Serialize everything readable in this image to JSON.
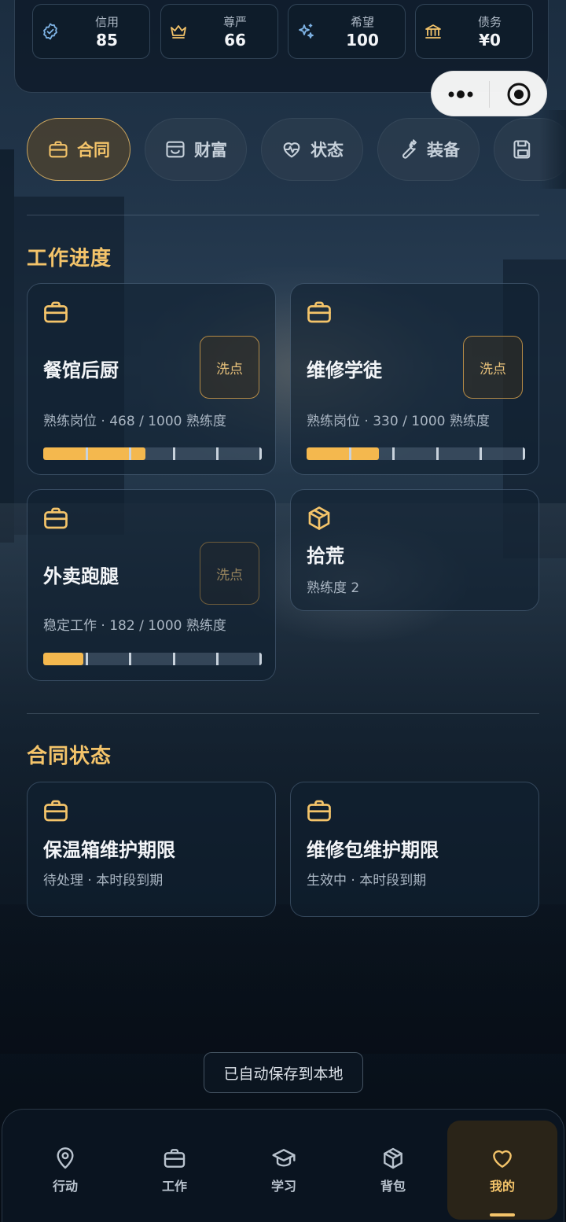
{
  "stats": [
    {
      "icon": "shield-check-icon",
      "label": "信用",
      "value": "85"
    },
    {
      "icon": "crown-icon",
      "label": "尊严",
      "value": "66"
    },
    {
      "icon": "sparkles-icon",
      "label": "希望",
      "value": "100"
    },
    {
      "icon": "bank-icon",
      "label": "债务",
      "value": "¥0"
    }
  ],
  "tabs": [
    {
      "icon": "briefcase-icon",
      "label": "合同",
      "active": true
    },
    {
      "icon": "wallet-icon",
      "label": "财富",
      "active": false
    },
    {
      "icon": "heart-pulse-icon",
      "label": "状态",
      "active": false
    },
    {
      "icon": "wrench-icon",
      "label": "装备",
      "active": false
    },
    {
      "icon": "save-icon",
      "label": "",
      "active": false
    }
  ],
  "work": {
    "title": "工作进度",
    "cards": [
      {
        "icon": "briefcase-icon",
        "name": "餐馆后厨",
        "detail": "熟练岗位 · 468 / 1000 熟练度",
        "progress": 0.468,
        "action": "洗点"
      },
      {
        "icon": "briefcase-icon",
        "name": "维修学徒",
        "detail": "熟练岗位 · 330 / 1000 熟练度",
        "progress": 0.33,
        "action": "洗点"
      },
      {
        "icon": "briefcase-icon",
        "name": "外卖跑腿",
        "detail": "稳定工作 · 182 / 1000 熟练度",
        "progress": 0.182,
        "action": "洗点"
      },
      {
        "icon": "box-icon",
        "name": "拾荒",
        "detail": "熟练度 2"
      }
    ]
  },
  "contract": {
    "title": "合同状态",
    "cards": [
      {
        "icon": "briefcase-icon",
        "name": "保温箱维护期限",
        "detail": "待处理 · 本时段到期"
      },
      {
        "icon": "briefcase-icon",
        "name": "维修包维护期限",
        "detail": "生效中 · 本时段到期"
      }
    ]
  },
  "toast": "已自动保存到本地",
  "nav": [
    {
      "icon": "location-pin-icon",
      "label": "行动"
    },
    {
      "icon": "briefcase-icon",
      "label": "工作"
    },
    {
      "icon": "graduation-cap-icon",
      "label": "学习"
    },
    {
      "icon": "box-icon",
      "label": "背包"
    },
    {
      "icon": "heart-icon",
      "label": "我的",
      "active": true
    }
  ],
  "colors": {
    "accent": "#f4c46a",
    "bar": "#f4b84e",
    "info_icon": "#7fb4e6"
  }
}
